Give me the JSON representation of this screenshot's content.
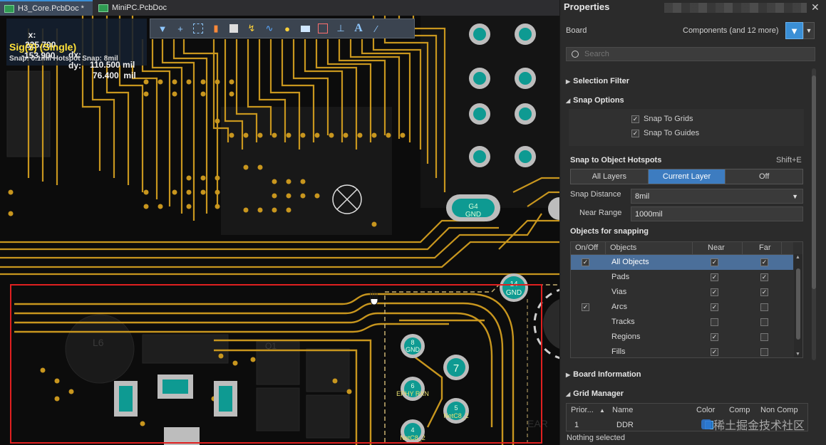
{
  "editor": {
    "tabs": [
      {
        "label": "H3_Core.PcbDoc *",
        "active": true
      },
      {
        "label": "MiniPC.PcbDoc",
        "active": false
      }
    ],
    "hud": {
      "x_label": "x:",
      "x_value": "225.700",
      "dx_label": "dx:",
      "dx_value": "110.500 mil",
      "y_label": "y:",
      "y_value": "-153.900",
      "dy_label": "dy:",
      "dy_value": "76.400  mil",
      "net": "Sig(3) (Single)",
      "snap": "Snap: 0.1mil Hotspot Snap: 8mil"
    },
    "toolbar_icons": [
      "filter-icon",
      "add-icon",
      "select-rect-icon",
      "chart-icon",
      "component-icon",
      "route-icon",
      "diff-pair-icon",
      "highlight-icon",
      "fill-icon",
      "region-icon",
      "dimension-icon",
      "text-icon",
      "line-icon"
    ],
    "board_labels": {
      "g4_gnd_top": "G4",
      "g4_gnd_bottom": "GND",
      "p14_top": "14",
      "p14_bottom": "GND",
      "l6": "L6",
      "q1": "Q1",
      "p8_top": "8",
      "p8_bottom": "GND",
      "p7": "7",
      "p6_top": "6",
      "p6_bottom": "EPHY RXN",
      "p5_top": "5",
      "p5_bottom": "NetC8_2",
      "p4_top": "4",
      "p4_bottom": "NetC8_2",
      "ear": "EAR"
    },
    "colors": {
      "trace": "#c8961e",
      "pad": "#0e9a92",
      "selection": "#e02020",
      "via_ring": "#bdbdbd"
    }
  },
  "properties": {
    "title": "Properties",
    "board_label": "Board",
    "board_value": "Components (and 12 more)",
    "search_placeholder": "Search",
    "sections": {
      "selection_filter": "Selection Filter",
      "snap_options": "Snap Options",
      "board_information": "Board Information",
      "grid_manager": "Grid Manager"
    },
    "snap_checks": [
      {
        "label": "Snap To Grids",
        "checked": true
      },
      {
        "label": "Snap To Guides",
        "checked": true
      }
    ],
    "hotspots": {
      "label": "Snap to Object Hotspots",
      "shortcut": "Shift+E",
      "options": [
        "All Layers",
        "Current Layer",
        "Off"
      ],
      "selected": "Current Layer"
    },
    "snap_distance": {
      "label": "Snap Distance",
      "value": "8mil"
    },
    "near_range": {
      "label": "Near Range",
      "value": "1000mil"
    },
    "objects_label": "Objects for snapping",
    "objects_table": {
      "headers": [
        "On/Off",
        "Objects",
        "Near",
        "Far"
      ],
      "rows": [
        {
          "on": true,
          "name": "All Objects",
          "near": true,
          "far": true,
          "selected": true
        },
        {
          "on": false,
          "name": "Pads",
          "near": true,
          "far": true,
          "selected": false
        },
        {
          "on": false,
          "name": "Vias",
          "near": true,
          "far": true,
          "selected": false
        },
        {
          "on": true,
          "name": "Arcs",
          "near": true,
          "far": false,
          "selected": false
        },
        {
          "on": false,
          "name": "Tracks",
          "near": false,
          "far": false,
          "selected": false
        },
        {
          "on": false,
          "name": "Regions",
          "near": true,
          "far": false,
          "selected": false
        },
        {
          "on": false,
          "name": "Fills",
          "near": true,
          "far": false,
          "selected": false
        }
      ]
    },
    "grid_table": {
      "headers": [
        "Prior...",
        "Name",
        "Color",
        "Comp",
        "Non Comp"
      ],
      "row": {
        "priority": "1",
        "name": "DDR"
      }
    },
    "status": "Nothing selected",
    "watermark": "稀土掘金技术社区"
  }
}
